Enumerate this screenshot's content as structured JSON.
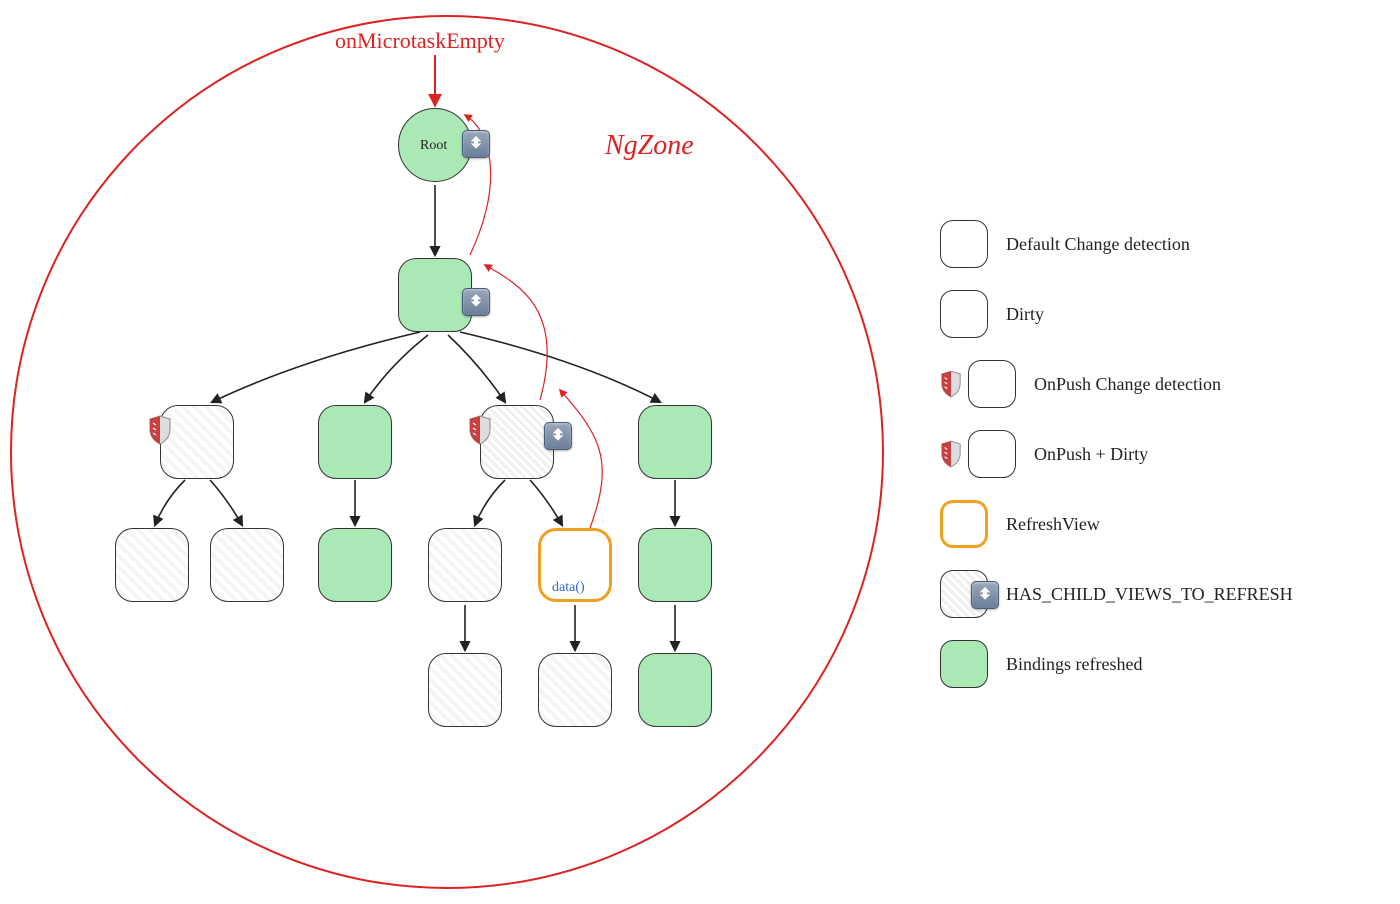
{
  "trigger_label": "onMicrotaskEmpty",
  "zone_label": "NgZone",
  "nodes": {
    "root": {
      "label": "Root"
    },
    "refreshview": {
      "label": "data()"
    }
  },
  "legend": {
    "default_cd": "Default Change detection",
    "dirty": "Dirty",
    "onpush_cd": "OnPush Change detection",
    "onpush_dirty": "OnPush + Dirty",
    "refreshview": "RefreshView",
    "has_child": "HAS_CHILD_VIEWS_TO_REFRESH",
    "refreshed": "Bindings refreshed"
  },
  "colors": {
    "zone_red": "#dd2222",
    "refreshed_green": "#aae8b6",
    "refreshview_orange": "#f0a020",
    "data_blue": "#3466cc"
  }
}
